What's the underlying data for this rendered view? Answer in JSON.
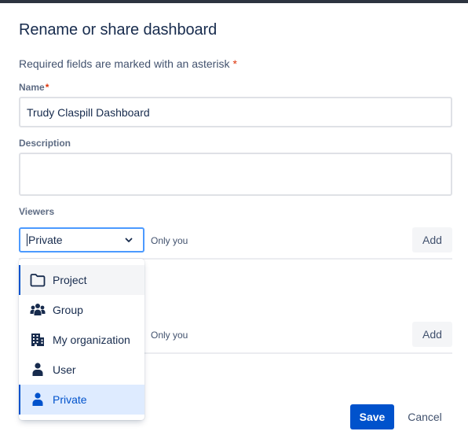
{
  "dialog": {
    "title": "Rename or share dashboard",
    "required_note": "Required fields are marked with an asterisk",
    "asterisk": "*"
  },
  "name_field": {
    "label": "Name",
    "value": "Trudy Claspill Dashboard"
  },
  "description_field": {
    "label": "Description",
    "value": ""
  },
  "viewers": {
    "label": "Viewers",
    "selected": "Private",
    "summary": "Only you",
    "add_label": "Add"
  },
  "editors": {
    "summary": "Only you",
    "add_label": "Add"
  },
  "dropdown": {
    "options": [
      {
        "label": "Project",
        "icon": "folder-icon"
      },
      {
        "label": "Group",
        "icon": "group-icon"
      },
      {
        "label": "My organization",
        "icon": "building-icon"
      },
      {
        "label": "User",
        "icon": "user-icon"
      },
      {
        "label": "Private",
        "icon": "user-icon"
      }
    ]
  },
  "footer": {
    "save_label": "Save",
    "cancel_label": "Cancel"
  },
  "colors": {
    "primary": "#0052cc",
    "selected_bg": "#deebff",
    "focus_border": "#4c9aff",
    "required": "#de350b"
  }
}
